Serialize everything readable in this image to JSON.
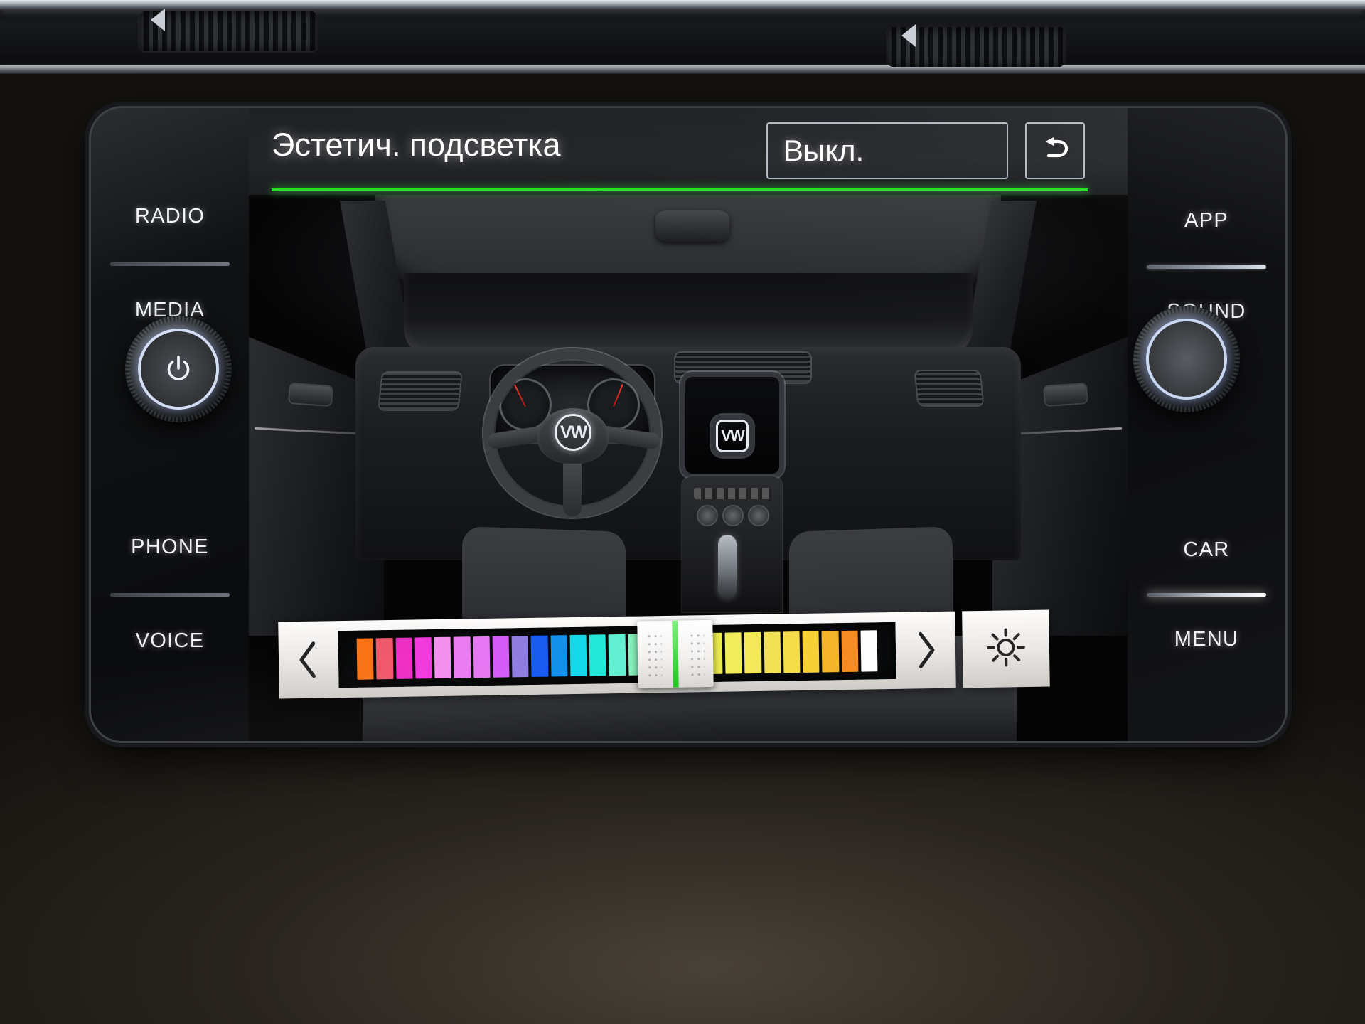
{
  "screen": {
    "header": {
      "title": "Эстетич. подсветка",
      "value": "Выкл.",
      "back_icon": "back-arrow-icon",
      "accent_color": "#2bdd2b"
    },
    "background_image": "vw-interior-ambient-lighting-preview",
    "slider": {
      "prev_icon": "chevron-left-icon",
      "next_icon": "chevron-right-icon",
      "brightness_icon": "brightness-sun-icon",
      "selected_index": 16,
      "colors": [
        "#f97316",
        "#f0596b",
        "#ee2fc4",
        "#f13bdd",
        "#f291ee",
        "#ea7df0",
        "#e778f3",
        "#d35cf6",
        "#8f7de0",
        "#1a5bf0",
        "#1390e8",
        "#13d8e8",
        "#22e8d8",
        "#63f0d2",
        "#86f2bd",
        "#9cf06a",
        "#5ce05c",
        "#b9e84a",
        "#ecec4f",
        "#f0ec5a",
        "#f2e85a",
        "#f2e055",
        "#f5dc4a",
        "#f7cf36",
        "#f5b52a",
        "#f58b22",
        "#fdfdfd"
      ]
    }
  },
  "soft_keys": {
    "left": [
      {
        "label": "RADIO"
      },
      {
        "label": "MEDIA"
      },
      {
        "label": "PHONE"
      },
      {
        "label": "VOICE"
      }
    ],
    "right": [
      {
        "label": "APP"
      },
      {
        "label": "SOUND"
      },
      {
        "label": "CAR"
      },
      {
        "label": "MENU"
      }
    ]
  },
  "hardware": {
    "left_knob": "power-volume-knob",
    "right_knob": "tuning-knob",
    "power_icon": "power-icon"
  }
}
